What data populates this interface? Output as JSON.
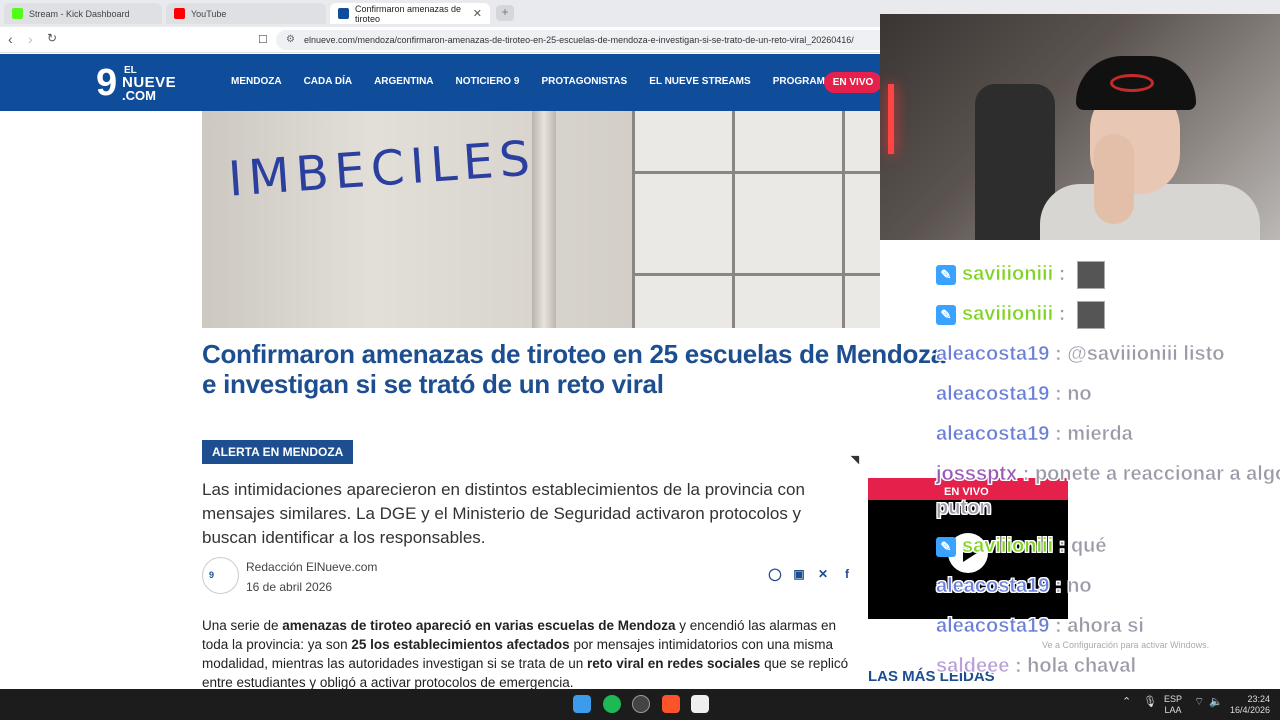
{
  "browser": {
    "tabs": [
      {
        "label": "Stream - Kick Dashboard",
        "favicon_color": "#53fc18"
      },
      {
        "label": "YouTube",
        "favicon_color": "#ff0000"
      },
      {
        "label": "Confirmaron amenazas de tiroteo",
        "favicon_color": "#0f4c9a"
      }
    ],
    "new_tab": "+",
    "url": "elnueve.com/mendoza/confirmaron-amenazas-de-tiroteo-en-25-escuelas-de-mendoza-e-investigan-si-se-trato-de-un-reto-viral_20260416/"
  },
  "site": {
    "logo": {
      "nine": "9",
      "el": "EL",
      "nueve": "NUEVE",
      "com": ".COM"
    },
    "nav": [
      "MENDOZA",
      "CADA DÍA",
      "ARGENTINA",
      "NOTICIERO 9",
      "PROTAGONISTAS",
      "EL NUEVE STREAMS",
      "PROGRAMACIÓN"
    ],
    "live_button": "EN VIVO",
    "brand_color": "#0f4c9a"
  },
  "article": {
    "image_text": "IMBECILES",
    "headline": "Confirmaron amenazas de tiroteo en 25 escuelas de Mendoza e investigan si se trató de un reto viral",
    "tag": "ALERTA EN MENDOZA",
    "lede": "Las intimidaciones aparecieron en distintos establecimientos de la provincia con mensajes similares. La DGE y el Ministerio de Seguridad activaron protocolos y buscan identificar a los responsables.",
    "author": "Redacción ElNueve.com",
    "date": "16 de abril 2026",
    "body": [
      {
        "text": "Una serie de ",
        "bold": false
      },
      {
        "text": "amenazas de tiroteo apareció en varias escuelas de Mendoza",
        "bold": true
      },
      {
        "text": " y encendió las alarmas en toda la provincia: ya son ",
        "bold": false
      },
      {
        "text": "25 los establecimientos afectados",
        "bold": true
      },
      {
        "text": " por mensajes intimidatorios con una misma modalidad, mientras las autoridades investigan si se trata de un ",
        "bold": false
      },
      {
        "text": "reto viral en redes sociales",
        "bold": true
      },
      {
        "text": " que se replicó entre estudiantes y obligó a activar protocolos de emergencia.",
        "bold": false
      }
    ],
    "sidebar_heading": "LAS MÁS LEÍDAS",
    "player_live": "EN VIVO"
  },
  "chat": [
    {
      "user": "saviiioniii",
      "sep": ":",
      "text": "",
      "badge": true,
      "emote": true,
      "color": "u-green"
    },
    {
      "user": "saviiioniii",
      "sep": ":",
      "text": "",
      "badge": true,
      "emote": true,
      "color": "u-green"
    },
    {
      "user": "aleacosta19",
      "sep": ":",
      "text": "@saviiioniii listo",
      "badge": false,
      "emote": false,
      "color": "u-blue"
    },
    {
      "user": "aleacosta19",
      "sep": ":",
      "text": "no",
      "badge": false,
      "emote": false,
      "color": "u-blue"
    },
    {
      "user": "aleacosta19",
      "sep": ":",
      "text": "mierda",
      "badge": false,
      "emote": false,
      "color": "u-blue"
    },
    {
      "user": "josssptx",
      "sep": ":",
      "text": "ponete a reaccionar a algo",
      "badge": false,
      "emote": false,
      "color": "u-purple"
    },
    {
      "user": "",
      "sep": "",
      "text": "puton",
      "badge": false,
      "emote": false,
      "color": "u-purple"
    },
    {
      "user": "saviiioniii",
      "sep": ":",
      "text": "qué",
      "badge": true,
      "emote": false,
      "color": "u-green"
    },
    {
      "user": "aleacosta19",
      "sep": ":",
      "text": "no",
      "badge": false,
      "emote": false,
      "color": "u-blue"
    },
    {
      "user": "aleacosta19",
      "sep": ":",
      "text": "ahora si",
      "badge": false,
      "emote": false,
      "color": "u-blue"
    },
    {
      "user": "saldeee",
      "sep": ":",
      "text": "hola chaval",
      "badge": false,
      "emote": false,
      "color": "u-lilac"
    }
  ],
  "windows_watermark": "Ve a Configuración para activar Windows.",
  "tray": {
    "lang": "ESP",
    "layout": "LAA",
    "time": "23:24",
    "date": "16/4/2026"
  }
}
